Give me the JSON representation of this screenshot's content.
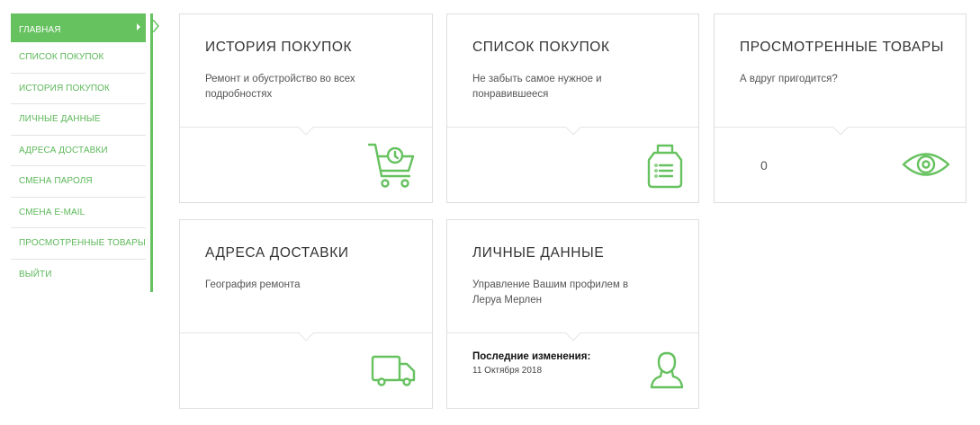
{
  "sidebar": {
    "items": [
      {
        "label": "Главная",
        "active": true
      },
      {
        "label": "Список покупок"
      },
      {
        "label": "История покупок"
      },
      {
        "label": "Личные данные"
      },
      {
        "label": "Адреса доставки"
      },
      {
        "label": "Смена пароля"
      },
      {
        "label": "Смена e-mail"
      },
      {
        "label": "Просмотренные товары"
      },
      {
        "label": "Выйти"
      }
    ]
  },
  "cards": {
    "history": {
      "title": "История покупок",
      "desc": "Ремонт и обустройство во всех подробностях",
      "icon": "cart-history-icon"
    },
    "list": {
      "title": "Список покупок",
      "desc": "Не забыть самое нужное и понравившееся",
      "icon": "shopping-bag-icon"
    },
    "viewed": {
      "title": "Просмотренные товары",
      "desc": "А вдруг пригодится?",
      "count": "0",
      "icon": "eye-icon"
    },
    "addresses": {
      "title": "Адреса доставки",
      "desc": "География ремонта",
      "icon": "truck-icon"
    },
    "personal": {
      "title": "Личные данные",
      "desc": "Управление Вашим профилем в Леруа Мерлен",
      "last_label": "Последние изменения:",
      "last_date": "11 Октября 2018",
      "icon": "user-icon"
    }
  },
  "colors": {
    "accent": "#66c15f",
    "text": "#333333",
    "border": "#dedede"
  }
}
